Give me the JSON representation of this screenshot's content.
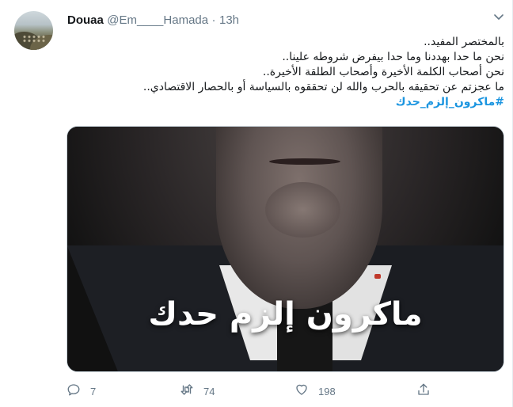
{
  "tweet": {
    "user": {
      "name": "Douaa",
      "handle": "@Em____Hamada",
      "separator": "·",
      "time": "13h"
    },
    "text_lines": [
      "بالمختصر المفيد..",
      "نحن ما حدا بهددنا وما حدا بيفرض شروطه علينا..",
      "نحن أصحاب الكلمة الأخيرة وأصحاب الطلقة الأخيرة..",
      "ما عجزتم عن تحقيقه بالحرب والله لن تحققوه بالسياسة أو بالحصار الاقتصادي.."
    ],
    "hashtag": "#ماكرون_إلزم_حدك",
    "media": {
      "overlay_text": "ماكرون إلزم حدك"
    },
    "actions": {
      "reply": {
        "icon": "reply-icon",
        "count": "7"
      },
      "retweet": {
        "icon": "retweet-icon",
        "count": "74"
      },
      "like": {
        "icon": "heart-icon",
        "count": "198"
      },
      "share": {
        "icon": "share-icon",
        "count": ""
      }
    }
  },
  "colors": {
    "text_primary": "#14171a",
    "text_secondary": "#657786",
    "link": "#1b95e0"
  }
}
